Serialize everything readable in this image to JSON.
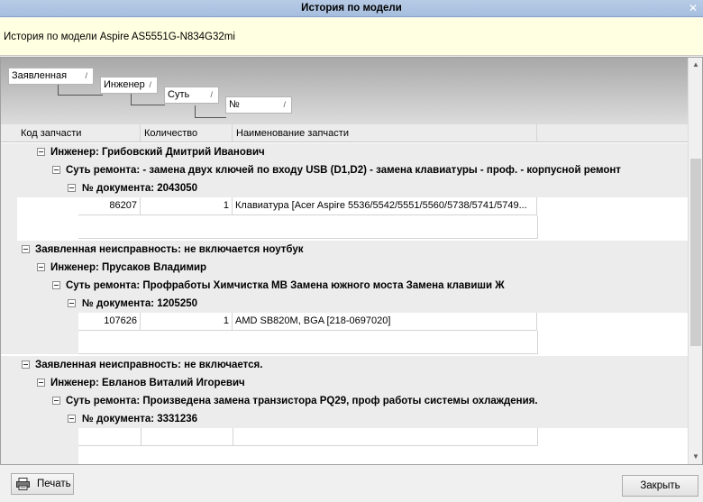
{
  "window": {
    "title": "История по модели",
    "close_glyph": "✕"
  },
  "header": {
    "text": "История по модели Aspire AS5551G-N834G32mi"
  },
  "group_panel": {
    "chips": [
      {
        "label": "Заявленная",
        "sort": "/"
      },
      {
        "label": "Инженер",
        "sort": "/"
      },
      {
        "label": "Суть",
        "sort": "/"
      },
      {
        "label": "№",
        "sort": "/"
      }
    ]
  },
  "columns": [
    "Код запчасти",
    "Количество",
    "Наименование запчасти"
  ],
  "rows": {
    "g1_engineer": "Инженер: Грибовский Дмитрий Иванович",
    "g1_essence": "Суть   ремонта: - замена двух ключей по входу USB (D1,D2)   - замена клавиатуры   - проф.   - корпусной ремонт",
    "g1_doc": "№   документа: 2043050",
    "g1_part": {
      "code": "86207",
      "qty": "1",
      "name": "Клавиатура [Acer Aspire 5536/5542/5551/5560/5738/5741/5749..."
    },
    "g2_claim": "Заявленная   неисправность: не включается ноутбук",
    "g2_engineer": "Инженер: Прусаков Владимир",
    "g2_essence": "Суть   ремонта: Профработы   Химчистка МВ   Замена южного моста   Замена клавиши Ж",
    "g2_doc": "№   документа: 1205250",
    "g2_part": {
      "code": "107626",
      "qty": "1",
      "name": "AMD SB820M, BGA [218-0697020]"
    },
    "g3_claim": "Заявленная   неисправность: не включается.",
    "g3_engineer": "Инженер: Евланов Виталий Игоревич",
    "g3_essence": "Суть   ремонта: Произведена замена транзистора PQ29, проф работы системы охлаждения.",
    "g3_doc": "№   документа: 3331236"
  },
  "buttons": {
    "print": "Печать",
    "close": "Закрыть"
  },
  "icons": {
    "print": "printer-icon",
    "expander": "minus-box-icon",
    "scroll_up": "▲",
    "scroll_down": "▼"
  }
}
